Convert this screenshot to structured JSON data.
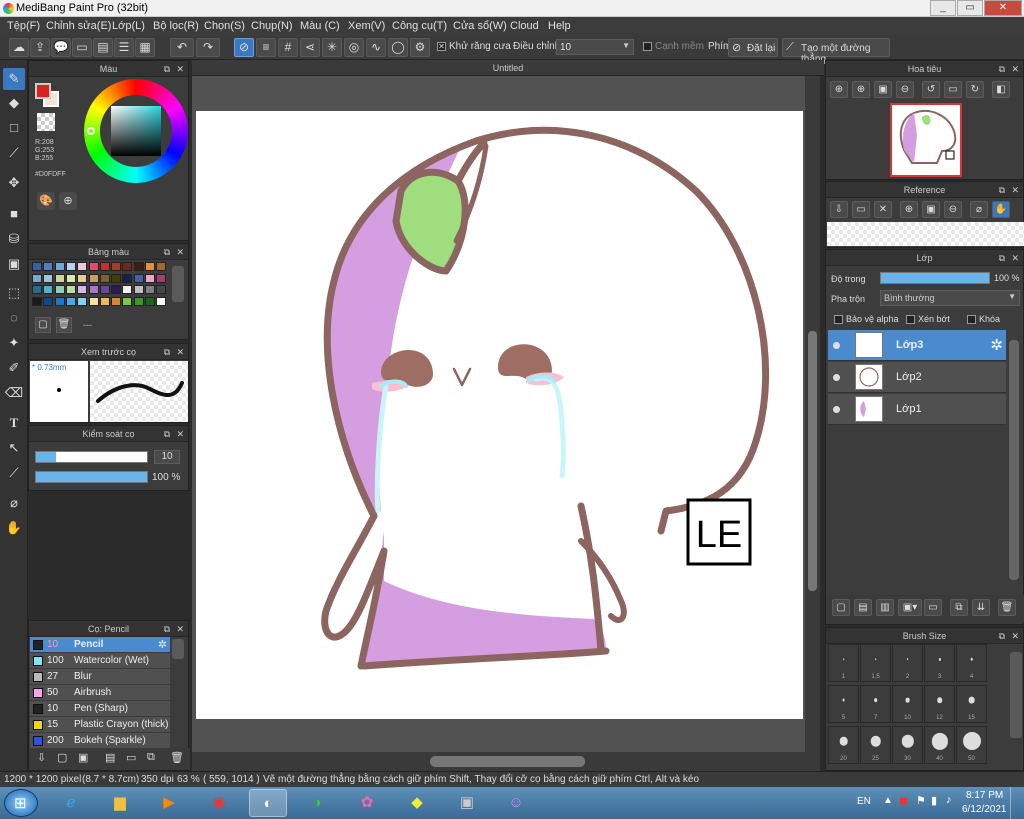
{
  "window": {
    "title": "MediBang Paint Pro (32bit)",
    "min": "_",
    "restore": "▭",
    "close": "✕"
  },
  "menu": [
    "Tệp(F)",
    "Chỉnh sửa(E)",
    "Lớp(L)",
    "Bộ lọc(R)",
    "Chọn(S)",
    "Chụp(N)",
    "Màu (C)",
    "Xem(V)",
    "Công cụ(T)",
    "Cửa sổ(W)",
    "Cloud",
    "Help"
  ],
  "toolbar": {
    "antialias_label": "Khử răng cưa",
    "adjust_label": "Điều chỉnh",
    "adjust_value": "10",
    "soft_edge_label": "Cạnh mềm",
    "key_label": "Phím",
    "reset_label": "Đặt lại",
    "straight_line_label": "Tạo một đường thẳng"
  },
  "color_panel": {
    "title": "Màu",
    "r": "R:208",
    "g": "G:253",
    "b": "B:255",
    "hex": "#D0FDFF",
    "primary": "#d8241e",
    "secondary": "#f6e3d2"
  },
  "palette_panel": {
    "title": "Bảng màu",
    "dash": "---",
    "colors": [
      "#3b5ea8",
      "#5a7abf",
      "#6fa8d8",
      "#b9d4ec",
      "#f0c8d8",
      "#e6486a",
      "#d22a2a",
      "#a73b2e",
      "#6b2a1b",
      "#3e1e0e",
      "#e69138",
      "#9c6b2f",
      "#74a8d0",
      "#a0c4e0",
      "#c8d8a0",
      "#d8e8b0",
      "#e8d090",
      "#c8a060",
      "#806030",
      "#404000",
      "#182050",
      "#4a60a8",
      "#e8a8c0",
      "#a04070",
      "#286b8c",
      "#58b0c8",
      "#90d0b8",
      "#b8e0a0",
      "#d8b8e8",
      "#a878c8",
      "#684898",
      "#301858",
      "#f0f0f0",
      "#c0c0c0",
      "#808080",
      "#484848",
      "#1a1a1a",
      "#0c4a8c",
      "#1a78c8",
      "#48a8e8",
      "#88d0f0",
      "#f8e0a0",
      "#f0b850",
      "#d88830",
      "#78c848",
      "#389828",
      "#186818",
      "#f8f8f8"
    ]
  },
  "preview_panel": {
    "title": "Xem trước cọ",
    "size": "0.73mm"
  },
  "brush_control": {
    "title": "Kiểm soát cọ",
    "size_value": "10",
    "opacity_value": "100 %"
  },
  "brush_list": {
    "title": "Cọ: Pencil",
    "items": [
      {
        "size": "10",
        "name": "Pencil",
        "color": "#222222",
        "selected": true
      },
      {
        "size": "100",
        "name": "Watercolor (Wet)",
        "color": "#7fe6f8"
      },
      {
        "size": "27",
        "name": "Blur",
        "color": "#bbbbbb"
      },
      {
        "size": "50",
        "name": "Airbrush",
        "color": "#f9a6f0"
      },
      {
        "size": "10",
        "name": "Pen (Sharp)",
        "color": "#222222"
      },
      {
        "size": "15",
        "name": "Plastic Crayon (thick)",
        "color": "#e8d818"
      },
      {
        "size": "200",
        "name": "Bokeh (Sparkle)",
        "color": "#3050e8"
      }
    ]
  },
  "document": {
    "tab": "Untitled",
    "logo_text": "LE"
  },
  "navigator": {
    "title": "Hoa tiêu"
  },
  "reference": {
    "title": "Reference"
  },
  "layers": {
    "title": "Lớp",
    "opacity_label": "Độ trong",
    "opacity_value": "100 %",
    "opacity_fraction": 1.0,
    "blend_label": "Pha trộn",
    "blend_value": "Bình thường",
    "alpha_protect": "Bảo vệ alpha",
    "clipping": "Xén bớt",
    "lock": "Khóa",
    "items": [
      {
        "name": "Lớp3",
        "selected": true
      },
      {
        "name": "Lớp2",
        "selected": false
      },
      {
        "name": "Lớp1",
        "selected": false
      }
    ]
  },
  "brush_size": {
    "title": "Brush Size",
    "sizes": [
      "1",
      "1.5",
      "2",
      "3",
      "4",
      "5",
      "7",
      "10",
      "12",
      "15",
      "20",
      "25",
      "30",
      "40",
      "50"
    ]
  },
  "status": {
    "dims": "1200 * 1200 pixel",
    "cm": "(8.7 * 8.7cm)",
    "dpi": "350 dpi",
    "zoom": "63 %",
    "coords": "( 559, 1014 )",
    "hint": "Vẽ một đường thẳng bằng cách giữ phím Shift, Thay đổi cỡ cọ bằng cách giữ phím Ctrl, Alt và kéo"
  },
  "taskbar": {
    "lang": "EN",
    "time": "8:17 PM",
    "date": "6/12/2021"
  }
}
